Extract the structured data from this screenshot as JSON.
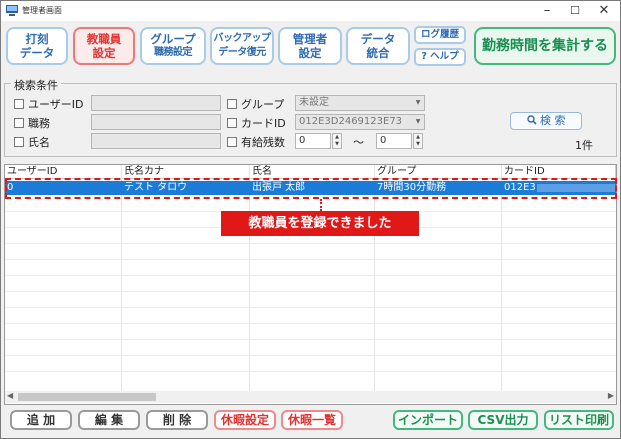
{
  "window": {
    "title": "管理者画面"
  },
  "toolbar": {
    "items": [
      {
        "line1": "打刻",
        "line2": "データ"
      },
      {
        "line1": "教職員",
        "line2": "設定"
      },
      {
        "line1": "グループ",
        "line2": "職務設定"
      },
      {
        "line1": "バックアップ",
        "line2": "データ復元"
      },
      {
        "line1": "管理者",
        "line2": "設定"
      },
      {
        "line1": "データ",
        "line2": "統合"
      }
    ],
    "log_label": "ログ履歴",
    "help_label": "? ヘルプ",
    "aggregate_label": "勤務時間を集計する"
  },
  "search": {
    "title": "検索条件",
    "labels": {
      "user_id": "ユーザーID",
      "role": "職務",
      "name": "氏名",
      "group": "グループ",
      "card_id": "カードID",
      "paid_leave": "有給残数"
    },
    "group_value": "未設定",
    "card_value": "012E3D2469123E73",
    "leave_from": "0",
    "leave_to": "0",
    "range_sep": "～",
    "button": "検 索",
    "count": "1件"
  },
  "table": {
    "headers": [
      "ユーザーID",
      "氏名カナ",
      "氏名",
      "グループ",
      "カードID"
    ],
    "rows": [
      {
        "user_id": "0",
        "kana": "テスト タロウ",
        "name": "出張戸 太郎",
        "group": "7時間30分勤務",
        "card": "012E3"
      }
    ]
  },
  "callout": "教職員を登録できました",
  "bottom": {
    "add": "追 加",
    "edit": "編 集",
    "delete": "削 除",
    "leave_settings": "休暇設定",
    "leave_list": "休暇一覧",
    "import": "インポート",
    "csv": "CSV出力",
    "print": "リスト印刷"
  },
  "colors": {
    "accent": "#2f6bb0",
    "active": "#e23333",
    "green": "#1a8f52",
    "selection": "#1b7bd6",
    "callout": "#e01818"
  }
}
